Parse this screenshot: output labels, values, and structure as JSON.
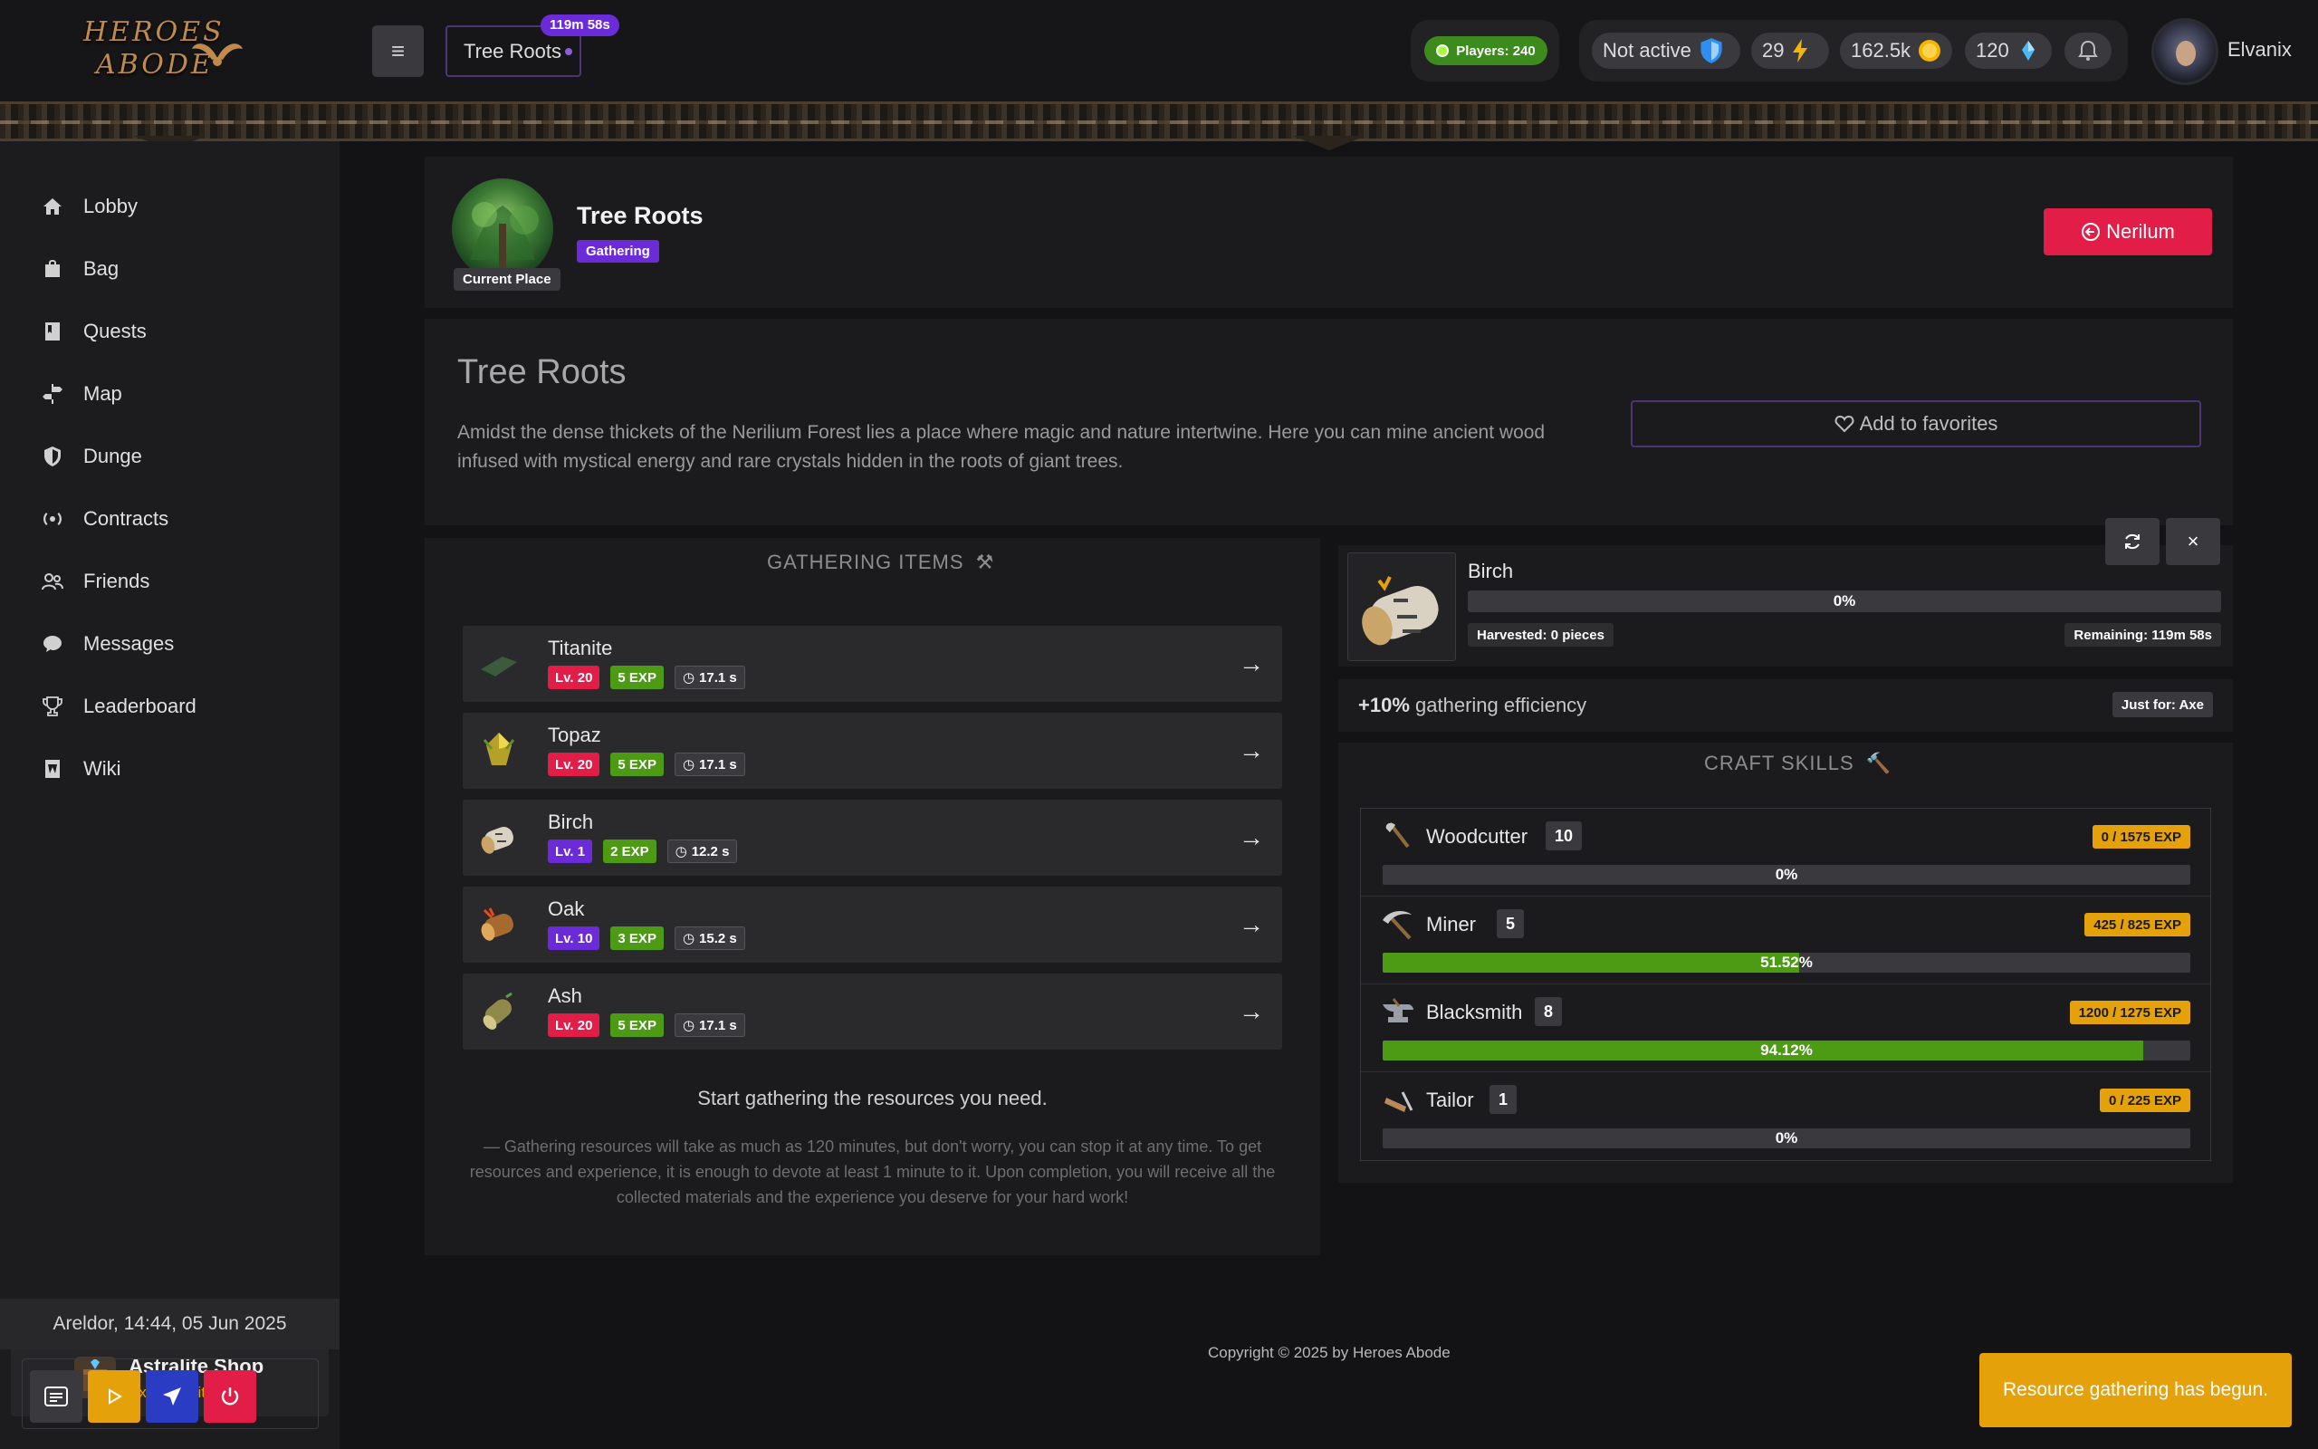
{
  "header": {
    "logo_line1": "HEROES",
    "logo_line2": "ABODE",
    "place_tab": "Tree Roots",
    "place_timer": "119m 58s",
    "players": "Players: 240",
    "status": "Not active",
    "energy": "29",
    "gold": "162.5k",
    "crystals": "120",
    "username": "Elvanix"
  },
  "sidebar": {
    "items": [
      {
        "label": "Lobby",
        "icon": "home-icon"
      },
      {
        "label": "Bag",
        "icon": "bag-icon"
      },
      {
        "label": "Quests",
        "icon": "book-icon"
      },
      {
        "label": "Map",
        "icon": "signpost-icon"
      },
      {
        "label": "Dunge",
        "icon": "shield-icon"
      },
      {
        "label": "Contracts",
        "icon": "broadcast-icon"
      },
      {
        "label": "Friends",
        "icon": "people-icon"
      },
      {
        "label": "Messages",
        "icon": "chat-icon"
      },
      {
        "label": "Leaderboard",
        "icon": "trophy-icon"
      },
      {
        "label": "Wiki",
        "icon": "wiki-icon"
      }
    ],
    "shop_title": "Astralite Shop",
    "shop_subtitle": "Exclusive items",
    "clock": "Areldor, 14:44, 05 Jun 2025"
  },
  "place": {
    "title": "Tree Roots",
    "badge": "Gathering",
    "current_label": "Current Place",
    "back_button": "Nerilum",
    "description_title": "Tree Roots",
    "description": "Amidst the dense thickets of the Nerilium Forest lies a place where magic and nature intertwine. Here you can mine ancient wood infused with mystical energy and rare crystals hidden in the roots of giant trees.",
    "favorite_button": "Add to favorites"
  },
  "gathering": {
    "title": "GATHERING ITEMS",
    "items": [
      {
        "name": "Titanite",
        "level": "Lv. 20",
        "exp": "5 EXP",
        "time": "17.1 s",
        "level_color": "#e11d48"
      },
      {
        "name": "Topaz",
        "level": "Lv. 20",
        "exp": "5 EXP",
        "time": "17.1 s",
        "level_color": "#e11d48"
      },
      {
        "name": "Birch",
        "level": "Lv. 1",
        "exp": "2 EXP",
        "time": "12.2 s",
        "level_color": "#6c2bd9"
      },
      {
        "name": "Oak",
        "level": "Lv. 10",
        "exp": "3 EXP",
        "time": "15.2 s",
        "level_color": "#6c2bd9"
      },
      {
        "name": "Ash",
        "level": "Lv. 20",
        "exp": "5 EXP",
        "time": "17.1 s",
        "level_color": "#e11d48"
      }
    ],
    "info_heading": "Start gathering the resources you need.",
    "info_text": "— Gathering resources will take as much as 120 minutes, but don't worry, you can stop it at any time. To get resources and experience, it is enough to devote at least 1 minute to it. Upon completion, you will receive all the collected materials and the experience you deserve for your hard work!"
  },
  "current_gather": {
    "name": "Birch",
    "progress": 0,
    "progress_label": "0%",
    "harvested": "Harvested: 0 pieces",
    "remaining": "Remaining: 119m 58s"
  },
  "efficiency": {
    "value": "+10%",
    "text": "gathering efficiency",
    "tag": "Just for: Axe"
  },
  "craft": {
    "title": "CRAFT SKILLS",
    "skills": [
      {
        "name": "Woodcutter",
        "level": "10",
        "exp": "0 / 1575 EXP",
        "progress": 0,
        "label": "0%",
        "icon": "axe-icon"
      },
      {
        "name": "Miner",
        "level": "5",
        "exp": "425 / 825 EXP",
        "progress": 51.52,
        "label": "51.52%",
        "icon": "pickaxe-icon"
      },
      {
        "name": "Blacksmith",
        "level": "8",
        "exp": "1200 / 1275 EXP",
        "progress": 94.12,
        "label": "94.12%",
        "icon": "anvil-icon"
      },
      {
        "name": "Tailor",
        "level": "1",
        "exp": "0 / 225 EXP",
        "progress": 0,
        "label": "0%",
        "icon": "needle-icon"
      }
    ]
  },
  "footer": {
    "copyright": "Copyright © 2025 by Heroes Abode"
  },
  "toast": {
    "message": "Resource gathering has begun."
  },
  "colors": {
    "accent_purple": "#6c2bd9",
    "accent_red": "#e11d48",
    "accent_green": "#4d9a14",
    "accent_gold": "#e5a10a"
  }
}
